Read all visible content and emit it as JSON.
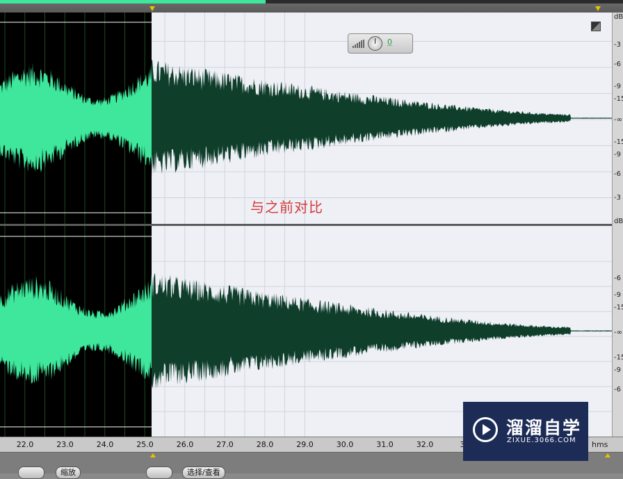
{
  "window": {
    "annotation": "与之前对比",
    "level_control": {
      "value": "0"
    }
  },
  "db_ruler": {
    "unit": "dB",
    "top_labels": [
      "dB",
      "-3",
      "-6",
      "-9",
      "-15",
      "-∞",
      "-15",
      "-9",
      "-6",
      "-3",
      "dB"
    ],
    "bottom_labels": [
      "-6",
      "-9",
      "-15",
      "-∞",
      "-15",
      "-9",
      "-6"
    ]
  },
  "time_ruler": {
    "labels": [
      "22.0",
      "23.0",
      "24.0",
      "25.0",
      "26.0",
      "27.0",
      "28.0",
      "29.0",
      "30.0",
      "31.0",
      "32.0",
      "33"
    ],
    "unit": "hms"
  },
  "selection": {
    "start_seconds": 21.4,
    "end_seconds": 25.2
  },
  "bottom_toolbar": {
    "buttons": [
      "缩放",
      "选择/查看"
    ]
  },
  "watermark": {
    "title": "溜溜自学",
    "url": "ZIXUE.3066.COM"
  },
  "colors": {
    "selected_wave": "#3ee79c",
    "unselected_wave": "#0f3e2b",
    "selection_background": "#000000",
    "view_background": "#eef0f6",
    "annotation": "#d13b3b",
    "watermark_bg": "#1d2c57"
  }
}
